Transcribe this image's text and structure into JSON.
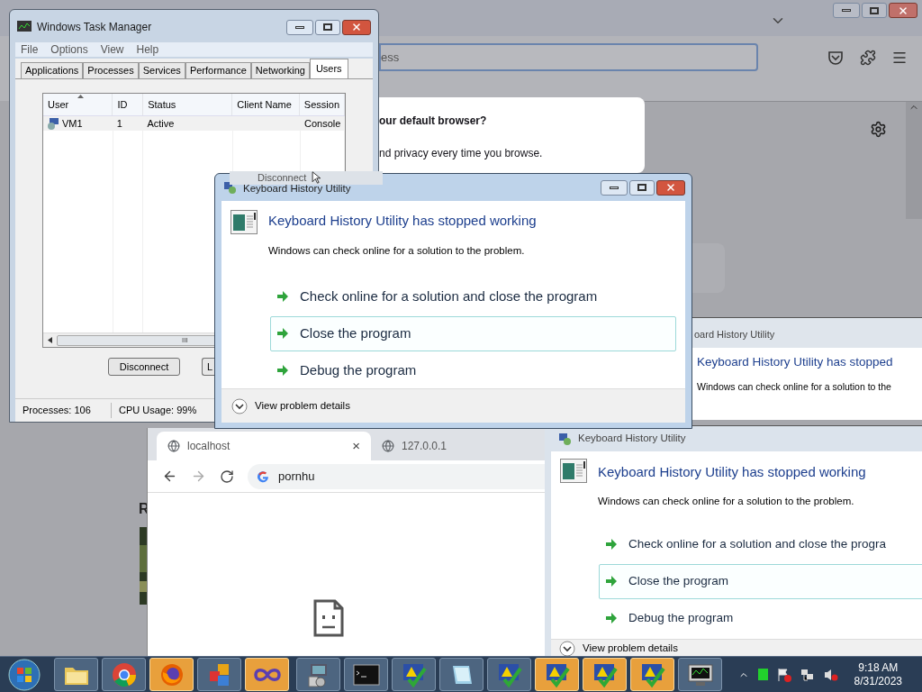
{
  "background_browser": {
    "address_fragment": "ess",
    "card_lines": [
      {
        "text": "our default browser?",
        "bold": true
      },
      {
        "text": "nd privacy every time you browse.",
        "bold": false
      }
    ],
    "page_fragment": "R"
  },
  "task_manager": {
    "title": "Windows Task Manager",
    "menu": [
      "File",
      "Options",
      "View",
      "Help"
    ],
    "tabs": [
      {
        "label": "Applications",
        "selected": false
      },
      {
        "label": "Processes",
        "selected": false
      },
      {
        "label": "Services",
        "selected": false
      },
      {
        "label": "Performance",
        "selected": false
      },
      {
        "label": "Networking",
        "selected": false
      },
      {
        "label": "Users",
        "selected": true
      }
    ],
    "columns": [
      "User",
      "ID",
      "Status",
      "Client Name",
      "Session"
    ],
    "rows": [
      {
        "cells": [
          "VM1",
          "1",
          "Active",
          "",
          "Console"
        ]
      }
    ],
    "scroll_grip": "III",
    "buttons": [
      "Disconnect",
      "L"
    ],
    "status": [
      "Processes: 106",
      "CPU Usage: 99%"
    ]
  },
  "tooltip": "Disconnect",
  "front_dialog": {
    "title": "Keyboard History Utility",
    "heading": "Keyboard History Utility has stopped working",
    "message": "Windows can check online for a solution to the problem.",
    "options": [
      {
        "label": "Check online for a solution and close the program",
        "highlighted": false
      },
      {
        "label": "Close the program",
        "highlighted": true
      },
      {
        "label": "Debug the program",
        "highlighted": false
      }
    ],
    "details": "View problem details"
  },
  "side_dialog": {
    "title": "oard History Utility",
    "heading": "Keyboard History Utility has stopped",
    "message": "Windows can check online for a solution to the"
  },
  "lower_dialog": {
    "title": "Keyboard History Utility",
    "heading": "Keyboard History Utility has stopped working",
    "message": "Windows can check online for a solution to the problem.",
    "options": [
      {
        "label": "Check online for a solution and close the progra",
        "highlighted": false
      },
      {
        "label": "Close the program",
        "highlighted": true
      },
      {
        "label": "Debug the program",
        "highlighted": false
      }
    ],
    "details": "View problem details"
  },
  "chrome": {
    "tabs": [
      {
        "label": "localhost",
        "selected": true
      },
      {
        "label": "127.0.0.1",
        "selected": false
      }
    ],
    "close_mark": "×",
    "omnibox": "pornhu"
  },
  "taskbar": {
    "items": [
      {
        "kind": "folder",
        "active": false
      },
      {
        "kind": "chrome",
        "active": false
      },
      {
        "kind": "firefox",
        "active": true
      },
      {
        "kind": "squares",
        "active": false
      },
      {
        "kind": "infinity",
        "active": true
      },
      {
        "kind": "installer",
        "active": false
      },
      {
        "kind": "console",
        "active": false
      },
      {
        "kind": "check",
        "active": false
      },
      {
        "kind": "notepad",
        "active": false
      },
      {
        "kind": "check",
        "active": false
      },
      {
        "kind": "check",
        "active": true
      },
      {
        "kind": "check",
        "active": true
      },
      {
        "kind": "check",
        "active": true
      },
      {
        "kind": "monitor",
        "active": false
      }
    ],
    "time": "9:18 AM",
    "date": "8/31/2023"
  }
}
